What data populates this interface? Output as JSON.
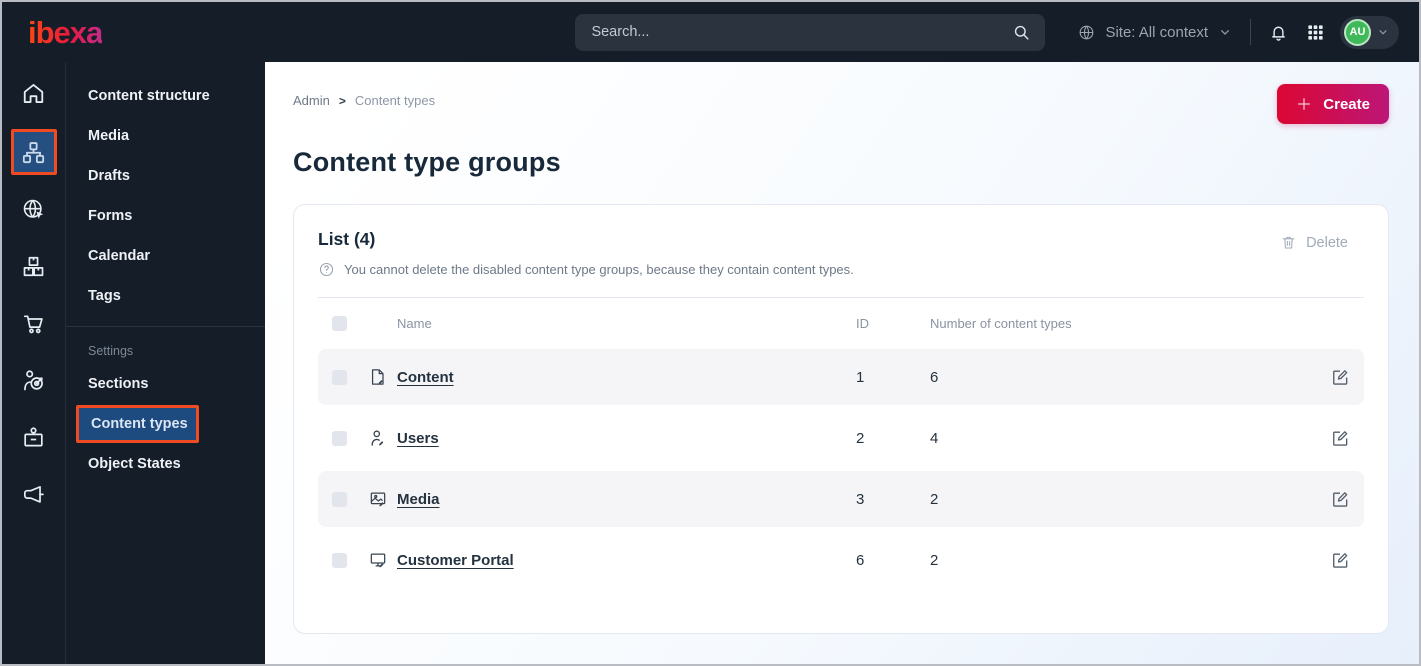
{
  "topbar": {
    "logo": "ibexa",
    "search": {
      "placeholder": "Search..."
    },
    "site_context": {
      "label": "Site: All context"
    },
    "avatar": {
      "initials": "AU"
    }
  },
  "rail": {
    "items": [
      {
        "icon": "home-icon",
        "active": false
      },
      {
        "icon": "content-structure-icon",
        "active": true
      },
      {
        "icon": "site-icon",
        "active": false
      },
      {
        "icon": "product-catalog-icon",
        "active": false
      },
      {
        "icon": "commerce-icon",
        "active": false
      },
      {
        "icon": "personalization-icon",
        "active": false
      },
      {
        "icon": "admin-icon",
        "active": false
      },
      {
        "icon": "marketing-icon",
        "active": false
      }
    ]
  },
  "sidebar": {
    "items": [
      {
        "label": "Content structure"
      },
      {
        "label": "Media"
      },
      {
        "label": "Drafts"
      },
      {
        "label": "Forms"
      },
      {
        "label": "Calendar"
      },
      {
        "label": "Tags"
      }
    ],
    "settings_label": "Settings",
    "settings_items": [
      {
        "label": "Sections",
        "active": false
      },
      {
        "label": "Content types",
        "active": true
      },
      {
        "label": "Object States",
        "active": false
      }
    ]
  },
  "breadcrumb": {
    "root": "Admin",
    "separator": ">",
    "current": "Content types"
  },
  "page": {
    "title": "Content type groups",
    "create_button": "Create"
  },
  "list": {
    "title": "List (4)",
    "note": "You cannot delete the disabled content type groups, because they contain content types.",
    "delete_button": "Delete",
    "table": {
      "headers": {
        "name": "Name",
        "id": "ID",
        "count": "Number of content types"
      },
      "rows": [
        {
          "icon": "file-edit-icon",
          "name": "Content",
          "id": "1",
          "count": "6"
        },
        {
          "icon": "user-edit-icon",
          "name": "Users",
          "id": "2",
          "count": "4"
        },
        {
          "icon": "image-edit-icon",
          "name": "Media",
          "id": "3",
          "count": "2"
        },
        {
          "icon": "monitor-edit-icon",
          "name": "Customer Portal",
          "id": "6",
          "count": "2"
        }
      ]
    }
  },
  "colors": {
    "topbar_bg": "#141d28",
    "accent_orange": "#f04b22",
    "active_blue": "#1d4b80",
    "create_gradient_start": "#dc0733",
    "create_gradient_end": "#bc1677",
    "avatar_green": "#3fb959",
    "row_stripe": "#f5f5f8",
    "page_gradient_end": "#e7effb"
  }
}
